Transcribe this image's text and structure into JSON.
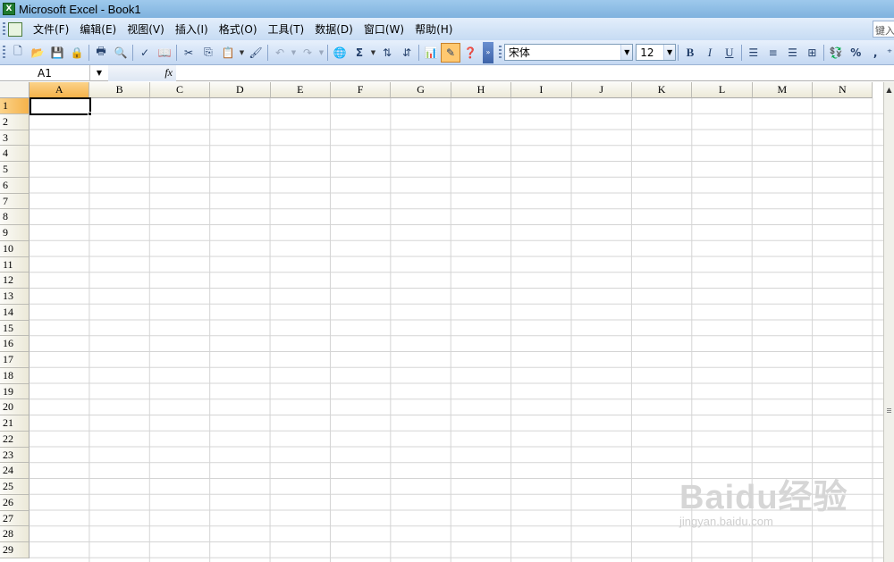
{
  "window": {
    "title": "Microsoft Excel - Book1"
  },
  "menu": {
    "items": [
      "文件(F)",
      "编辑(E)",
      "视图(V)",
      "插入(I)",
      "格式(O)",
      "工具(T)",
      "数据(D)",
      "窗口(W)",
      "帮助(H)"
    ],
    "help_box": "键入"
  },
  "toolbar": {
    "font_name": "宋体",
    "font_size": "12",
    "bold": "B",
    "italic": "I",
    "underline": "U",
    "sum": "Σ",
    "percent": "%",
    "comma": ","
  },
  "formula_bar": {
    "name_box": "A1",
    "fx": "fx",
    "formula": ""
  },
  "sheet": {
    "columns": [
      "A",
      "B",
      "C",
      "D",
      "E",
      "F",
      "G",
      "H",
      "I",
      "J",
      "K",
      "L",
      "M",
      "N"
    ],
    "rows": [
      "1",
      "2",
      "3",
      "4",
      "5",
      "6",
      "7",
      "8",
      "9",
      "10",
      "11",
      "12",
      "13",
      "14",
      "15",
      "16",
      "17",
      "18",
      "19",
      "20",
      "21",
      "22",
      "23",
      "24",
      "25",
      "26",
      "27",
      "28",
      "29"
    ],
    "selected_cell": "A1"
  },
  "watermark": {
    "brand": "Baidu经验",
    "url": "jingyan.baidu.com"
  },
  "colors": {
    "selected_header": "#f5b24a",
    "titlebar": "#7fb2de",
    "menubar": "#c6dbf3"
  }
}
